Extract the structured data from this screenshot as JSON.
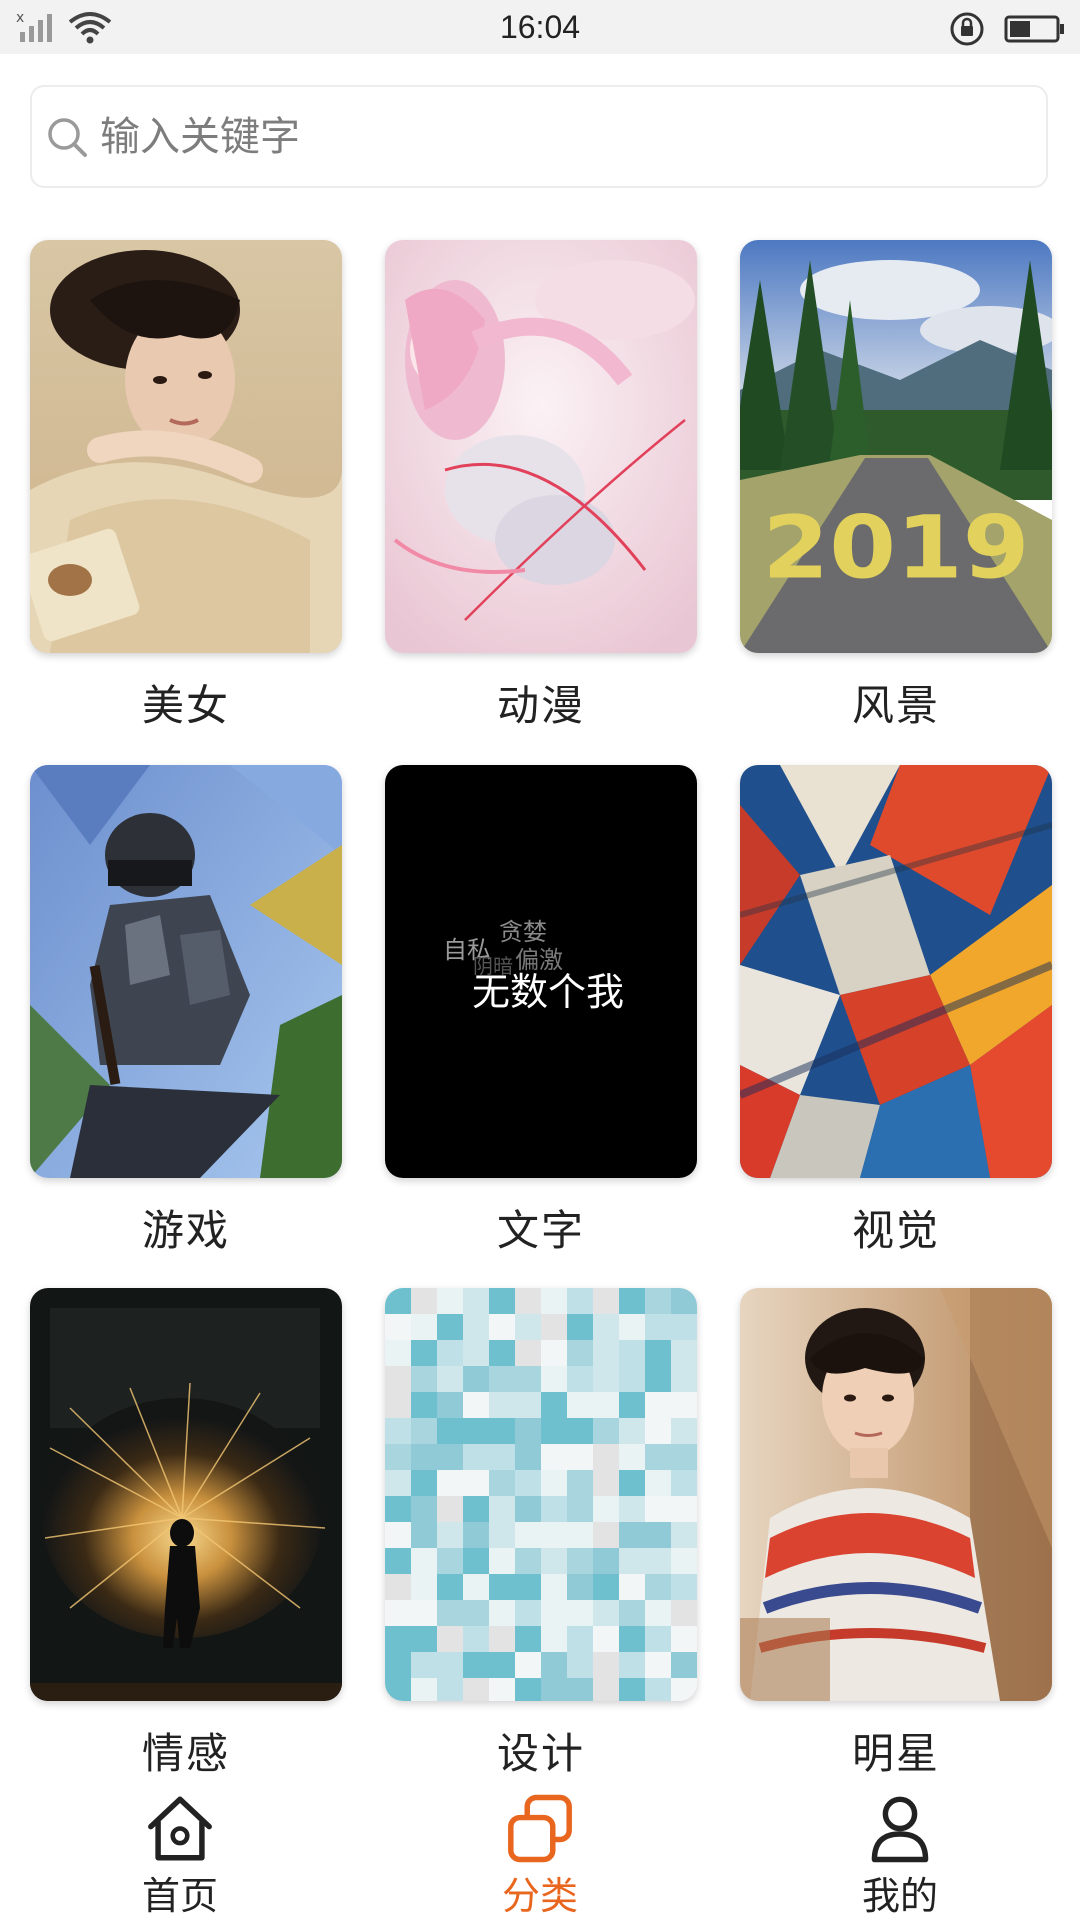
{
  "status_bar": {
    "time": "16:04",
    "icons": [
      "signal-icon",
      "wifi-icon",
      "rotation-lock-icon",
      "battery-icon"
    ]
  },
  "search": {
    "placeholder": "输入关键字",
    "value": ""
  },
  "categories": [
    {
      "label": "美女",
      "image": "girl-lying-photo"
    },
    {
      "label": "动漫",
      "image": "anime-girl-pink-illustration"
    },
    {
      "label": "风景",
      "image": "forest-road-2019-photo"
    },
    {
      "label": "游戏",
      "image": "soldier-helmet-game-art"
    },
    {
      "label": "文字",
      "image": "black-text-wallpaper"
    },
    {
      "label": "视觉",
      "image": "abstract-paint-diamonds"
    },
    {
      "label": "情感",
      "image": "sparkler-silhouette-photo"
    },
    {
      "label": "设计",
      "image": "teal-pixel-mosaic"
    },
    {
      "label": "明星",
      "image": "young-man-sweater-photo"
    }
  ],
  "text_wallpaper": {
    "small_words": [
      "贪婪",
      "自私",
      "阴暗",
      "偏激"
    ],
    "main_text": "无数个我"
  },
  "road_text": "2019",
  "bottom_nav": {
    "items": [
      {
        "label": "首页",
        "icon": "home-icon",
        "active": false
      },
      {
        "label": "分类",
        "icon": "category-icon",
        "active": true
      },
      {
        "label": "我的",
        "icon": "user-icon",
        "active": false
      }
    ]
  },
  "colors": {
    "accent": "#e9661f",
    "status_bar_bg": "#f2f2f2",
    "text": "#222222"
  }
}
